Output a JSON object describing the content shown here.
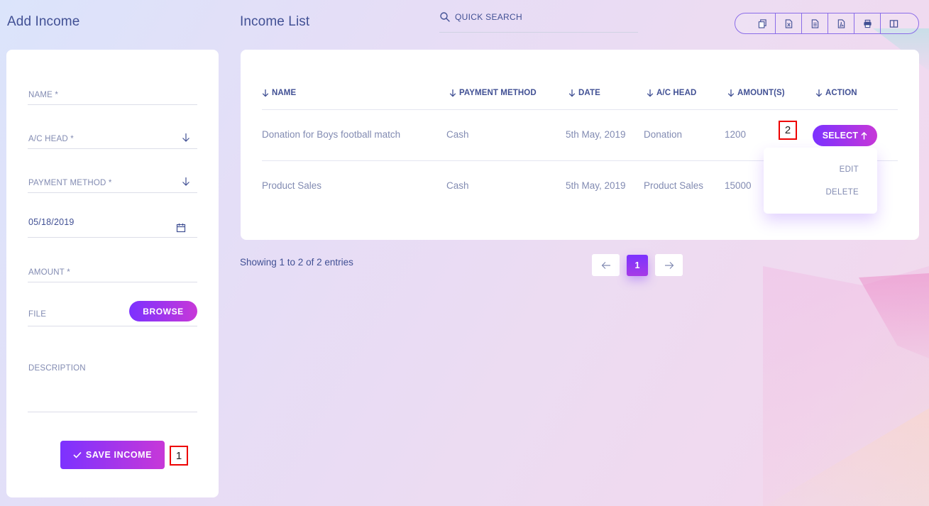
{
  "add_income": {
    "title": "Add Income",
    "fields": {
      "name_label": "NAME *",
      "ac_head_label": "A/C HEAD *",
      "payment_method_label": "PAYMENT METHOD *",
      "date_value": "05/18/2019",
      "amount_label": "AMOUNT *",
      "file_label": "FILE",
      "description_label": "DESCRIPTION"
    },
    "browse_label": "BROWSE",
    "save_label": "SAVE INCOME",
    "save_callout": "1"
  },
  "income_list": {
    "title": "Income List",
    "search_placeholder": "QUICK SEARCH",
    "export_buttons": [
      "copy-icon",
      "excel-icon",
      "csv-icon",
      "pdf-icon",
      "print-icon",
      "columns-icon"
    ],
    "columns": [
      "NAME",
      "PAYMENT METHOD",
      "DATE",
      "A/C HEAD",
      "AMOUNT(S)",
      "ACTION"
    ],
    "rows": [
      {
        "name": "Donation for Boys football match",
        "payment_method": "Cash",
        "date": "5th May, 2019",
        "ac_head": "Donation",
        "amount": "1200"
      },
      {
        "name": "Product Sales",
        "payment_method": "Cash",
        "date": "5th May, 2019",
        "ac_head": "Product Sales",
        "amount": "15000"
      }
    ],
    "select_label": "SELECT",
    "select_callout": "2",
    "dropdown": {
      "edit": "EDIT",
      "delete": "DELETE"
    },
    "entries_text": "Showing 1 to 2 of 2 entries",
    "current_page": "1"
  },
  "colors": {
    "accent_start": "#7c32ff",
    "accent_end": "#c738d8",
    "text": "#415094",
    "muted": "#828bb2"
  }
}
